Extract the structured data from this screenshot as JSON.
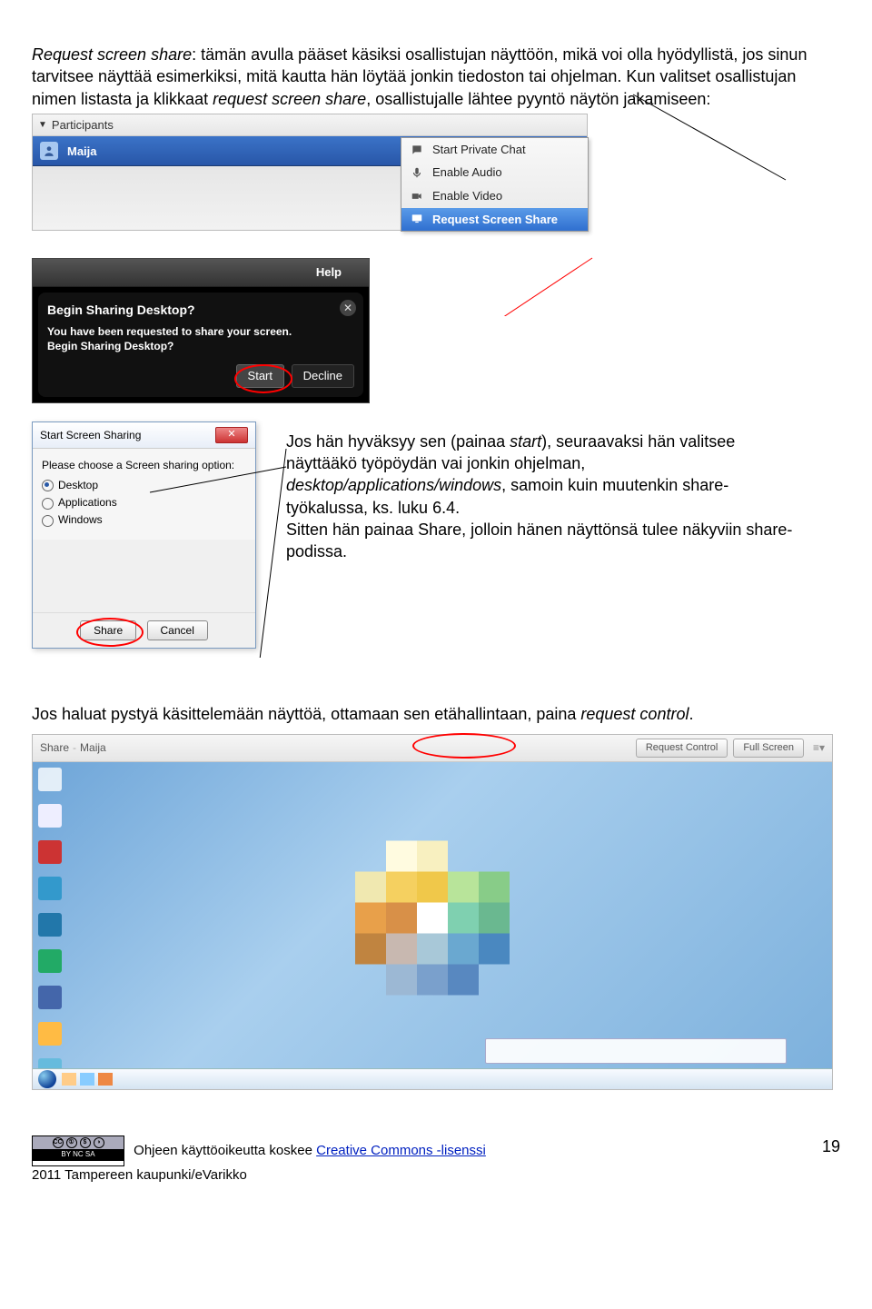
{
  "para1_lead": "Request screen share",
  "para1_rest": ": tämän avulla pääset käsiksi osallistujan näyttöön, mikä voi olla hyödyllistä, jos sinun tarvitsee näyttää esimerkiksi, mitä kautta hän löytää jonkin tiedoston tai ohjelman. Kun valitset osallistujan nimen listasta ja klikkaat ",
  "para1_req": "request screen share",
  "para1_end": ", osallistujalle lähtee pyyntö näytön jakamiseen:",
  "participants": {
    "header": "Participants",
    "name": "Maija",
    "menu": {
      "chat": "Start Private Chat",
      "audio": "Enable Audio",
      "video": "Enable Video",
      "rss": "Request Screen Share"
    }
  },
  "dark": {
    "help": "Help",
    "title": "Begin Sharing Desktop?",
    "line1": "You have been requested to share your screen.",
    "line2": "Begin Sharing Desktop?",
    "start": "Start",
    "decline": "Decline"
  },
  "win": {
    "title": "Start Screen Sharing",
    "prompt": "Please choose a Screen sharing option:",
    "opt1": "Desktop",
    "opt2": "Applications",
    "opt3": "Windows",
    "share": "Share",
    "cancel": "Cancel"
  },
  "side": {
    "t1a": "Jos hän hyväksyy sen (painaa ",
    "t1b": "start",
    "t1c": "), seuraavaksi hän valitsee näyttääkö työpöydän vai jonkin ohjelman, ",
    "t1d": "desktop/applications/windows",
    "t1e": ", samoin kuin muutenkin share-työkalussa, ks. luku 6.4.",
    "t2": "Sitten hän painaa Share, jolloin hänen näyttönsä tulee näkyviin share-podissa."
  },
  "para2a": "Jos haluat pystyä käsittelemään näyttöä, ottamaan sen etähallintaan, paina ",
  "para2b": "request control",
  "para2c": ".",
  "sharebar": {
    "label": "Share",
    "name": "Maija",
    "rc": "Request Control",
    "fs": "Full Screen"
  },
  "footer": {
    "text": "Ohjeen käyttöoikeutta koskee ",
    "link": "Creative Commons -lisenssi",
    "copy": "2011 Tampereen kaupunki/eVarikko",
    "cc": "BY  NC  SA",
    "page": "19"
  }
}
